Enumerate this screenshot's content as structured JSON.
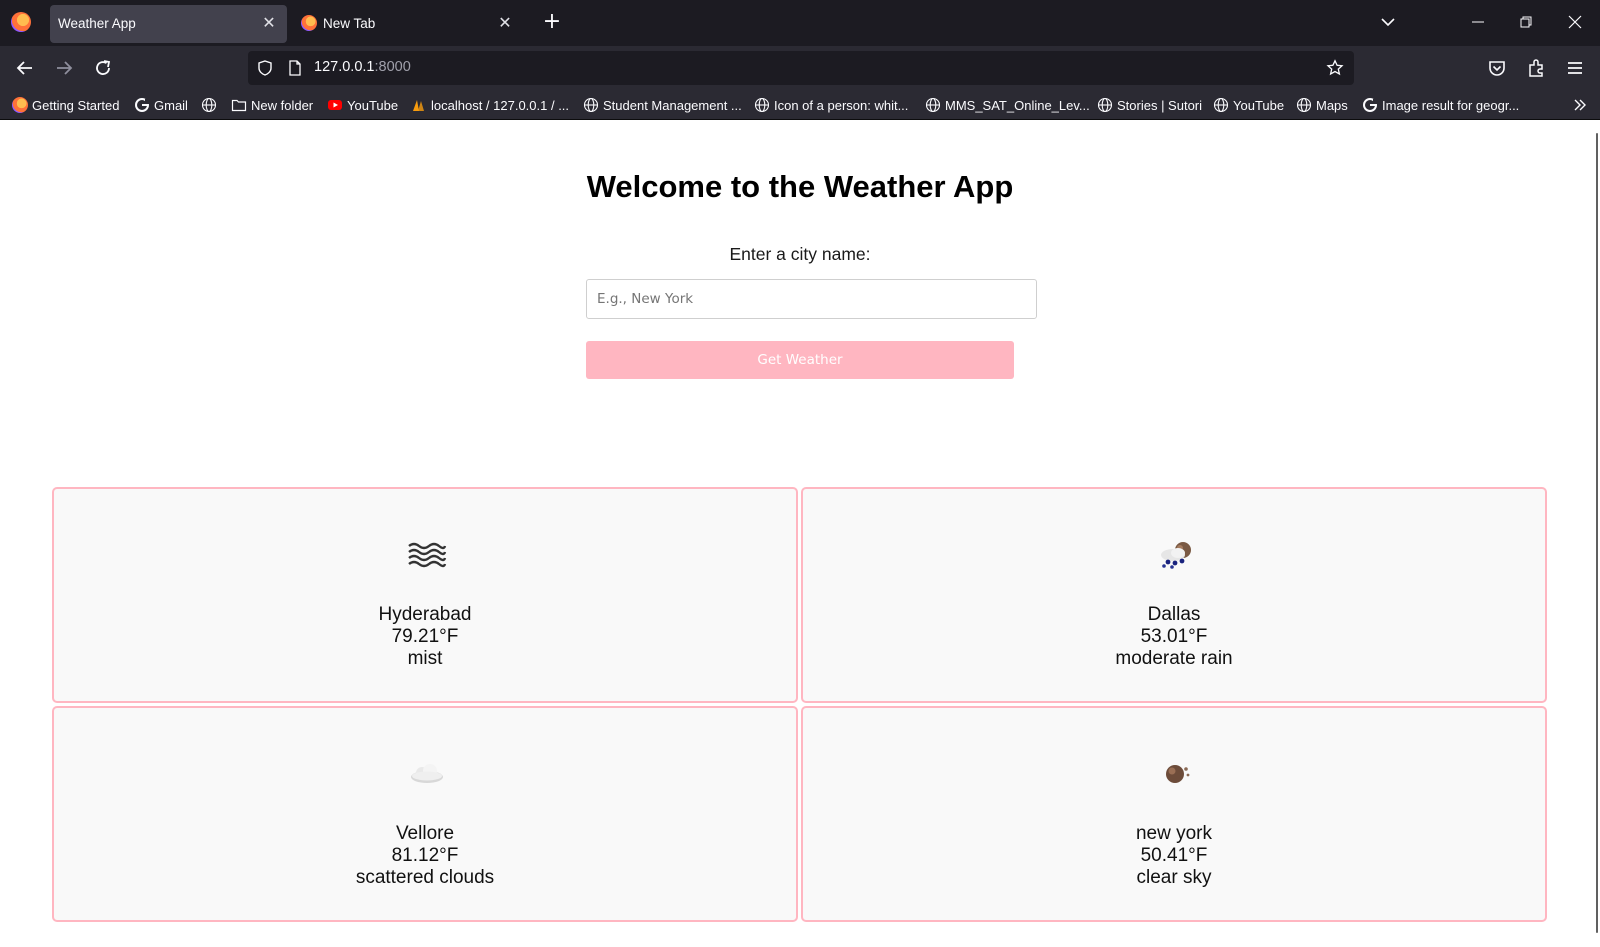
{
  "browser": {
    "tabs": [
      {
        "label": "Weather App",
        "active": true
      },
      {
        "label": "New Tab",
        "active": false
      }
    ],
    "url": {
      "host": "127.0.0.1",
      "port": ":8000"
    },
    "bookmarks": [
      {
        "label": "Getting Started",
        "icon": "firefox-icon"
      },
      {
        "label": "Gmail",
        "icon": "google-icon"
      },
      {
        "label": "",
        "icon": "globe-icon"
      },
      {
        "label": "New folder",
        "icon": "folder-icon"
      },
      {
        "label": "YouTube",
        "icon": "youtube-icon"
      },
      {
        "label": "localhost / 127.0.0.1 / ...",
        "icon": "phpmyadmin-icon"
      },
      {
        "label": "Student Management ...",
        "icon": "globe-icon"
      },
      {
        "label": "Icon of a person: whit...",
        "icon": "globe-icon"
      },
      {
        "label": "MMS_SAT_Online_Lev...",
        "icon": "globe-icon"
      },
      {
        "label": "Stories | Sutori",
        "icon": "globe-icon"
      },
      {
        "label": "YouTube",
        "icon": "globe-icon"
      },
      {
        "label": "Maps",
        "icon": "globe-icon"
      },
      {
        "label": "Image result for geogr...",
        "icon": "google-icon"
      }
    ]
  },
  "page": {
    "title": "Welcome to the Weather App",
    "city_label": "Enter a city name:",
    "city_input": {
      "value": "",
      "placeholder": "E.g., New York"
    },
    "button_label": "Get Weather",
    "accent_color": "#ffb6c1"
  },
  "cards": [
    {
      "city": "Hyderabad",
      "temp": "79.21°F",
      "desc": "mist",
      "icon": "mist-icon"
    },
    {
      "city": "Dallas",
      "temp": "53.01°F",
      "desc": "moderate rain",
      "icon": "rain-icon"
    },
    {
      "city": "Vellore",
      "temp": "81.12°F",
      "desc": "scattered clouds",
      "icon": "cloud-icon"
    },
    {
      "city": "new york",
      "temp": "50.41°F",
      "desc": "clear sky",
      "icon": "clear-sky-icon"
    }
  ]
}
